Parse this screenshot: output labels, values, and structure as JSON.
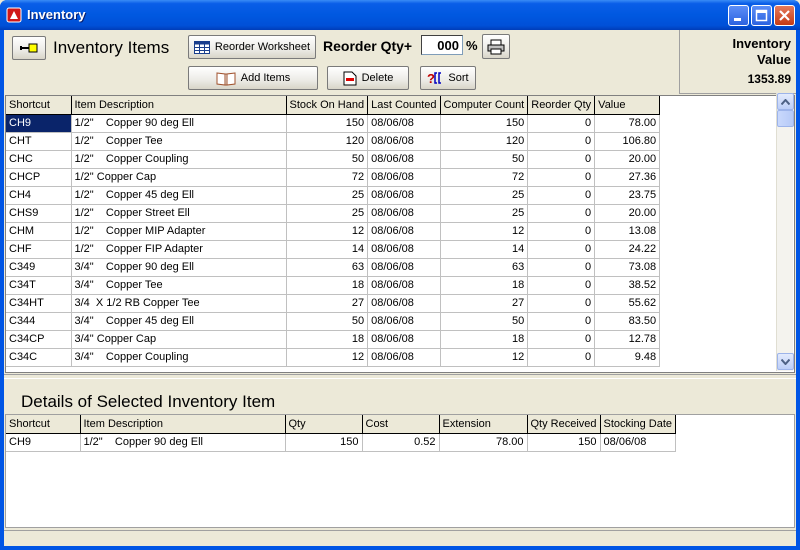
{
  "window": {
    "title": "Inventory"
  },
  "toolbar": {
    "heading": "Inventory Items",
    "reorder_worksheet_label": "Reorder Worksheet",
    "reorder_qty_label": "Reorder Qty+",
    "reorder_qty_value": "000",
    "percent_sign": "%",
    "add_items_label": "Add Items",
    "delete_label": "Delete",
    "sort_label": "Sort"
  },
  "inventory_value": {
    "title_line1": "Inventory",
    "title_line2": "Value",
    "amount": "1353.89"
  },
  "main_table": {
    "columns": [
      "Shortcut",
      "Item Description",
      "Stock On Hand",
      "Last Counted",
      "Computer Count",
      "Reorder Qty",
      "Value"
    ],
    "rows": [
      [
        "CH9",
        "1/2\"    Copper 90 deg Ell",
        "150",
        "08/06/08",
        "150",
        "0",
        "78.00"
      ],
      [
        "CHT",
        "1/2\"    Copper Tee",
        "120",
        "08/06/08",
        "120",
        "0",
        "106.80"
      ],
      [
        "CHC",
        "1/2\"    Copper Coupling",
        "50",
        "08/06/08",
        "50",
        "0",
        "20.00"
      ],
      [
        "CHCP",
        "1/2\" Copper Cap",
        "72",
        "08/06/08",
        "72",
        "0",
        "27.36"
      ],
      [
        "CH4",
        "1/2\"    Copper 45 deg Ell",
        "25",
        "08/06/08",
        "25",
        "0",
        "23.75"
      ],
      [
        "CHS9",
        "1/2\"    Copper Street Ell",
        "25",
        "08/06/08",
        "25",
        "0",
        "20.00"
      ],
      [
        "CHM",
        "1/2\"    Copper MIP Adapter",
        "12",
        "08/06/08",
        "12",
        "0",
        "13.08"
      ],
      [
        "CHF",
        "1/2\"    Copper FIP Adapter",
        "14",
        "08/06/08",
        "14",
        "0",
        "24.22"
      ],
      [
        "C349",
        "3/4\"    Copper 90 deg Ell",
        "63",
        "08/06/08",
        "63",
        "0",
        "73.08"
      ],
      [
        "C34T",
        "3/4\"    Copper Tee",
        "18",
        "08/06/08",
        "18",
        "0",
        "38.52"
      ],
      [
        "C34HT",
        "3/4  X 1/2 RB Copper Tee",
        "27",
        "08/06/08",
        "27",
        "0",
        "55.62"
      ],
      [
        "C344",
        "3/4\"    Copper 45 deg Ell",
        "50",
        "08/06/08",
        "50",
        "0",
        "83.50"
      ],
      [
        "C34CP",
        "3/4\" Copper Cap",
        "18",
        "08/06/08",
        "18",
        "0",
        "12.78"
      ],
      [
        "C34C",
        "3/4\"    Copper Coupling",
        "12",
        "08/06/08",
        "12",
        "0",
        "9.48"
      ]
    ]
  },
  "details": {
    "title": "Details of Selected Inventory Item",
    "columns": [
      "Shortcut",
      "Item Description",
      "Qty",
      "Cost",
      "Extension",
      "Qty Received",
      "Stocking Date"
    ],
    "rows": [
      [
        "CH9",
        "1/2\"    Copper 90 deg Ell",
        "150",
        "0.52",
        "78.00",
        "150",
        "08/06/08"
      ]
    ]
  }
}
